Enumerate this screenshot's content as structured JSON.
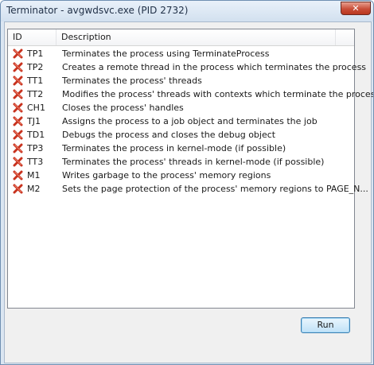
{
  "window": {
    "title": "Terminator - avgwdsvc.exe (PID 2732)",
    "close_glyph": "✕"
  },
  "listview": {
    "columns": [
      "ID",
      "Description"
    ],
    "rows": [
      {
        "id": "TP1",
        "description": "Terminates the process using TerminateProcess",
        "icon": "red-x-icon"
      },
      {
        "id": "TP2",
        "description": "Creates a remote thread in the process which terminates the process",
        "icon": "red-x-icon"
      },
      {
        "id": "TT1",
        "description": "Terminates the process' threads",
        "icon": "red-x-icon"
      },
      {
        "id": "TT2",
        "description": "Modifies the process' threads with contexts which terminate the process",
        "icon": "red-x-icon"
      },
      {
        "id": "CH1",
        "description": "Closes the process' handles",
        "icon": "red-x-icon"
      },
      {
        "id": "TJ1",
        "description": "Assigns the process to a job object and terminates the job",
        "icon": "red-x-icon"
      },
      {
        "id": "TD1",
        "description": "Debugs the process and closes the debug object",
        "icon": "red-x-icon"
      },
      {
        "id": "TP3",
        "description": "Terminates the process in kernel-mode (if possible)",
        "icon": "red-x-icon"
      },
      {
        "id": "TT3",
        "description": "Terminates the process' threads in kernel-mode (if possible)",
        "icon": "red-x-icon"
      },
      {
        "id": "M1",
        "description": "Writes garbage to the process' memory regions",
        "icon": "red-x-icon"
      },
      {
        "id": "M2",
        "description": "Sets the page protection of the process' memory regions to PAGE_N...",
        "icon": "red-x-icon"
      }
    ]
  },
  "buttons": {
    "run_label": "Run"
  },
  "colors": {
    "fail_icon": "#c8321e",
    "button_border": "#3c7fb1"
  }
}
